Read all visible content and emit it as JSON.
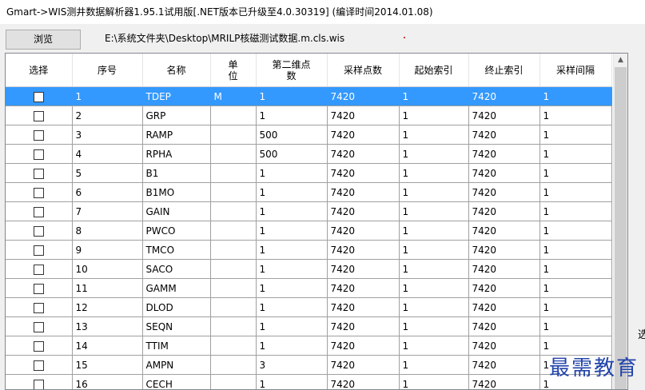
{
  "window": {
    "title": "Gmart->WIS测井数据解析器1.95.1试用版[.NET版本已升级至4.0.30319] (编译时间2014.01.08)"
  },
  "toolbar": {
    "browse_label": "浏览",
    "file_path": "E:\\系统文件夹\\Desktop\\MRILP核磁测试数据.m.cls.wis"
  },
  "grid": {
    "columns": [
      "选择",
      "序号",
      "名称",
      "单\n位",
      "第二维点\n数",
      "采样点数",
      "起始索引",
      "终止索引",
      "采样间隔"
    ],
    "rows": [
      {
        "checked": false,
        "index": "1",
        "name": "TDEP",
        "unit": "M",
        "dim2": "1",
        "samples": "7420",
        "start": "1",
        "end": "7420",
        "interval": "1"
      },
      {
        "checked": false,
        "index": "2",
        "name": "GRP",
        "unit": "",
        "dim2": "1",
        "samples": "7420",
        "start": "1",
        "end": "7420",
        "interval": "1"
      },
      {
        "checked": false,
        "index": "3",
        "name": "RAMP",
        "unit": "",
        "dim2": "500",
        "samples": "7420",
        "start": "1",
        "end": "7420",
        "interval": "1"
      },
      {
        "checked": false,
        "index": "4",
        "name": "RPHA",
        "unit": "",
        "dim2": "500",
        "samples": "7420",
        "start": "1",
        "end": "7420",
        "interval": "1"
      },
      {
        "checked": false,
        "index": "5",
        "name": "B1",
        "unit": "",
        "dim2": "1",
        "samples": "7420",
        "start": "1",
        "end": "7420",
        "interval": "1"
      },
      {
        "checked": false,
        "index": "6",
        "name": "B1MO",
        "unit": "",
        "dim2": "1",
        "samples": "7420",
        "start": "1",
        "end": "7420",
        "interval": "1"
      },
      {
        "checked": false,
        "index": "7",
        "name": "GAIN",
        "unit": "",
        "dim2": "1",
        "samples": "7420",
        "start": "1",
        "end": "7420",
        "interval": "1"
      },
      {
        "checked": false,
        "index": "8",
        "name": "PWCO",
        "unit": "",
        "dim2": "1",
        "samples": "7420",
        "start": "1",
        "end": "7420",
        "interval": "1"
      },
      {
        "checked": false,
        "index": "9",
        "name": "TMCO",
        "unit": "",
        "dim2": "1",
        "samples": "7420",
        "start": "1",
        "end": "7420",
        "interval": "1"
      },
      {
        "checked": false,
        "index": "10",
        "name": "SACO",
        "unit": "",
        "dim2": "1",
        "samples": "7420",
        "start": "1",
        "end": "7420",
        "interval": "1"
      },
      {
        "checked": false,
        "index": "11",
        "name": "GAMM",
        "unit": "",
        "dim2": "1",
        "samples": "7420",
        "start": "1",
        "end": "7420",
        "interval": "1"
      },
      {
        "checked": false,
        "index": "12",
        "name": "DLOD",
        "unit": "",
        "dim2": "1",
        "samples": "7420",
        "start": "1",
        "end": "7420",
        "interval": "1"
      },
      {
        "checked": false,
        "index": "13",
        "name": "SEQN",
        "unit": "",
        "dim2": "1",
        "samples": "7420",
        "start": "1",
        "end": "7420",
        "interval": "1"
      },
      {
        "checked": false,
        "index": "14",
        "name": "TTIM",
        "unit": "",
        "dim2": "1",
        "samples": "7420",
        "start": "1",
        "end": "7420",
        "interval": "1"
      },
      {
        "checked": false,
        "index": "15",
        "name": "AMPN",
        "unit": "",
        "dim2": "3",
        "samples": "7420",
        "start": "1",
        "end": "7420",
        "interval": "1"
      },
      {
        "checked": false,
        "index": "16",
        "name": "CECH",
        "unit": "",
        "dim2": "1",
        "samples": "7420",
        "start": "1",
        "end": "7420",
        "interval": "1"
      }
    ],
    "selected_row": 0
  },
  "scrollbar": {
    "up_arrow_icon": "chevron-up-icon"
  },
  "side_fragment": "选",
  "watermark": "最需教育",
  "colors": {
    "selection": "#3399ff",
    "watermark": "#2244aa"
  }
}
